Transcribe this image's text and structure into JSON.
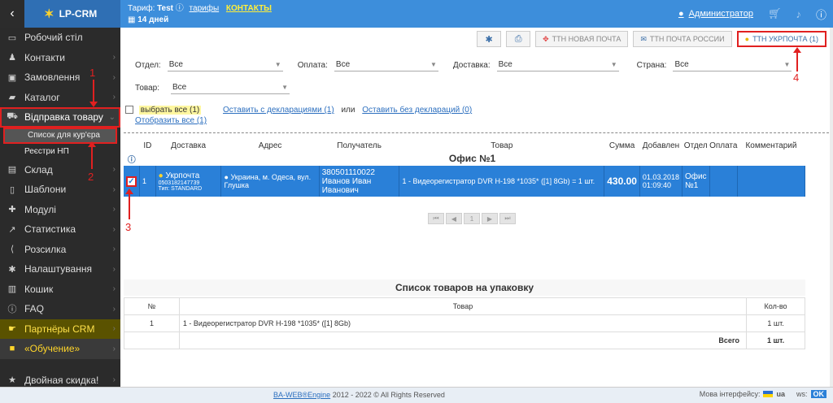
{
  "topbar": {
    "back_icon": "chevron-left-icon",
    "logo_text": "LP-CRM",
    "tariff_label": "Тариф:",
    "tariff_name": "Test",
    "tariffs_link": "тарифы",
    "contacts_link": "КОНТАКТЫ",
    "days_left": "14 дней",
    "user_name": "Администратор",
    "icons": [
      "user-icon",
      "cart-icon",
      "bell-icon",
      "info-icon"
    ]
  },
  "sidebar": {
    "items": [
      {
        "label": "Робочий стіл",
        "icon": "monitor-icon"
      },
      {
        "label": "Контакти",
        "icon": "users-icon"
      },
      {
        "label": "Замовлення",
        "icon": "money-icon"
      },
      {
        "label": "Каталог",
        "icon": "folder-icon"
      },
      {
        "label": "Відправка товару",
        "icon": "truck-icon"
      },
      {
        "label": "Список для кур'єра",
        "icon": ""
      },
      {
        "label": "Реєстри НП",
        "icon": ""
      },
      {
        "label": "Склад",
        "icon": "warehouse-icon"
      },
      {
        "label": "Шаблони",
        "icon": "document-icon"
      },
      {
        "label": "Модулі",
        "icon": "puzzle-icon"
      },
      {
        "label": "Статистика",
        "icon": "chart-icon"
      },
      {
        "label": "Розсилка",
        "icon": "share-icon"
      },
      {
        "label": "Налаштування",
        "icon": "gear-icon"
      },
      {
        "label": "Кошик",
        "icon": "trash-icon"
      },
      {
        "label": "FAQ",
        "icon": "info-icon"
      },
      {
        "label": "Партнёры CRM",
        "icon": "handshake-icon"
      },
      {
        "label": "«Обучение»",
        "icon": "video-icon"
      },
      {
        "label": "Двойная скидка!",
        "icon": "star-icon"
      }
    ]
  },
  "toolbar": {
    "np_label": "ТТН НОВАЯ ПОЧТА",
    "rp_label": "ТТН ПОЧТА РОССИИ",
    "ukr_label": "ТТН УКРПОЧТА (1)"
  },
  "filters": {
    "otdel_label": "Отдел:",
    "otdel_value": "Все",
    "oplata_label": "Оплата:",
    "oplata_value": "Все",
    "dostavka_label": "Доставка:",
    "dostavka_value": "Все",
    "strana_label": "Страна:",
    "strana_value": "Все",
    "tovar_label": "Товар:",
    "tovar_value": "Все"
  },
  "selection": {
    "select_all": "выбрать все (1)",
    "with_decl": "Оставить с декларациями (1)",
    "or_text": "или",
    "without_decl": "Оставить без деклараций (0)",
    "show_all": "Отобразить все (1)"
  },
  "orders": {
    "headers": [
      "ID",
      "Доставка",
      "Адрес",
      "Получатель",
      "Товар",
      "Сумма",
      "Добавлен",
      "Отдел",
      "Оплата",
      "Комментарий"
    ],
    "group_title": "Офис №1",
    "row": {
      "id": "1",
      "delivery_name": "Укрпочта",
      "delivery_tracking": "0503182147739",
      "delivery_type": "Тип: STANDARD",
      "address": "Украина, м. Одеса, вул. Глушка",
      "phone": "380501110022",
      "recipient": "Иванов Иван Иванович",
      "product": "1 - Видеорегистратор DVR H-198 *1035* ([1] 8Gb) = 1 шт.",
      "sum": "430.00",
      "date": "01.03.2018",
      "time": "01:09:40",
      "otdel": "Офис №1"
    },
    "pager_page": "1"
  },
  "packing": {
    "title": "Список товаров на упаковку",
    "headers": [
      "№",
      "Товар",
      "Кол-во"
    ],
    "rows": [
      {
        "n": "1",
        "product": "1 - Видеорегистратор DVR H-198 *1035* ([1] 8Gb)",
        "qty": "1 шт."
      }
    ],
    "total_label": "Всего",
    "total_qty": "1 шт."
  },
  "footer": {
    "engine_link": "BA-WEB®Engine",
    "copyright": "2012 - 2022 © All Rights Reserved",
    "lang_label": "Мова інтерфейсу:",
    "lang_code": "ua",
    "ws": "ws:",
    "ws_status": "OK"
  },
  "annotations": [
    "1",
    "2",
    "3",
    "4"
  ]
}
